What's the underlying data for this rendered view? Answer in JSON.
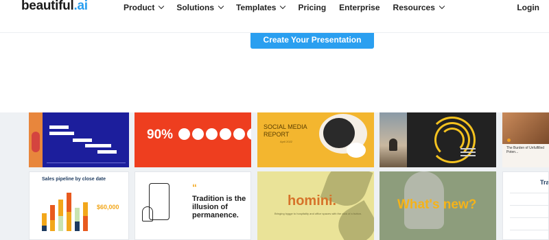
{
  "header": {
    "logo_text": "beautiful",
    "logo_suffix": ".ai",
    "nav": [
      {
        "label": "Product",
        "has_dropdown": true
      },
      {
        "label": "Solutions",
        "has_dropdown": true
      },
      {
        "label": "Templates",
        "has_dropdown": true
      },
      {
        "label": "Pricing",
        "has_dropdown": false
      },
      {
        "label": "Enterprise",
        "has_dropdown": false
      },
      {
        "label": "Resources",
        "has_dropdown": true
      }
    ],
    "login_label": "Login"
  },
  "cta": {
    "label": "Create Your Presentation"
  },
  "gallery": {
    "tiles": [
      {
        "name": "timeline-slide"
      },
      {
        "name": "percentage-slide",
        "stat": "90%"
      },
      {
        "name": "social-media-report-slide",
        "title": "SOCIAL MEDIA REPORT",
        "subtitle": "April 2022"
      },
      {
        "name": "donut-chart-slide"
      },
      {
        "name": "burden-slide",
        "title": "The Burden of Unfulfilled Poten..."
      },
      {
        "name": "sales-pipeline-slide",
        "title": "Sales pipeline by close date",
        "value": "$60,000"
      },
      {
        "name": "quote-slide",
        "quote_mark": "“",
        "quote": "Tradition is the illusion of permanence."
      },
      {
        "name": "homini-slide",
        "title": "homini.",
        "subtitle": "Bringing hygge to hospitality and office spaces with the click of a button."
      },
      {
        "name": "whats-new-slide",
        "title": "What's new?"
      },
      {
        "name": "traffic-slide",
        "title": "Traf"
      }
    ]
  },
  "colors": {
    "accent": "#2a9ff0",
    "orange": "#ee3e1f",
    "gold": "#f3b62f",
    "navy": "#1c1e9c"
  }
}
